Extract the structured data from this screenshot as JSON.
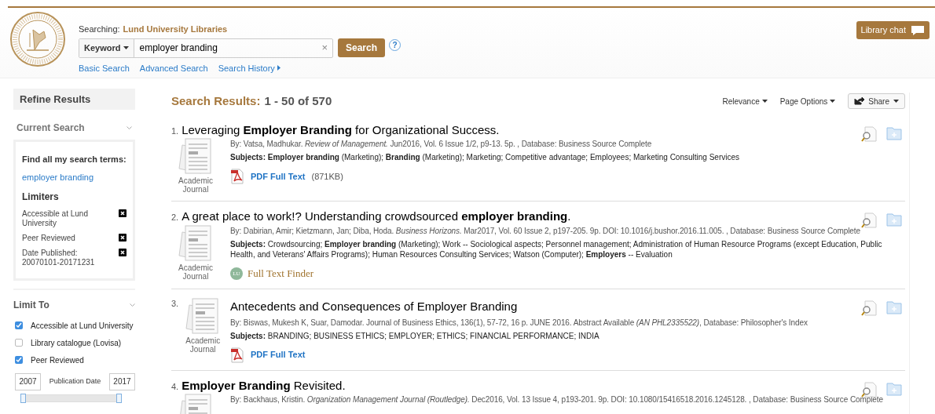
{
  "header": {
    "searching_label": "Searching:",
    "searching_target": "Lund University Libraries",
    "field_type": "Keyword",
    "query": "employer branding",
    "clear": "×",
    "search_button": "Search",
    "help": "?",
    "links": [
      {
        "label": "Basic Search",
        "arrow": false
      },
      {
        "label": "Advanced Search",
        "arrow": false
      },
      {
        "label": "Search History",
        "arrow": true
      }
    ],
    "chat_button": "Library chat"
  },
  "sidebar": {
    "title": "Refine Results",
    "current_search": {
      "heading": "Current Search",
      "find_label": "Find all my search terms:",
      "term": "employer branding",
      "limiters_heading": "Limiters",
      "limiters": [
        {
          "label": "Accessible at Lund University"
        },
        {
          "label": "Peer Reviewed"
        },
        {
          "label": "Date Published: 20070101-20171231"
        }
      ]
    },
    "limit_to": {
      "heading": "Limit To",
      "options": [
        {
          "label": "Accessible at Lund University",
          "checked": true
        },
        {
          "label": "Library catalogue (Lovisa)",
          "checked": false
        },
        {
          "label": "Peer Reviewed",
          "checked": true
        }
      ],
      "date_from": "2007",
      "date_label": "Publication Date",
      "date_to": "2017",
      "slider_thumbs": [
        {
          "level": 0
        },
        {
          "level": 1
        }
      ]
    }
  },
  "results": {
    "heading": "Search Results:",
    "range": "1 - 50 of 570",
    "sort": "Relevance",
    "page_options": "Page Options",
    "share": "Share",
    "items": [
      {
        "number": "1.",
        "title": "Leveraging **Employer Branding** for Organizational Success.",
        "kind": "stacked",
        "type": "Academic Journal",
        "byline": "By: Vatsa, Madhukar. *Review of Management.* Jun2016, Vol. 6 Issue 1/2, p9-13. 5p. , Database: Business Source Complete",
        "subjects": "**Subjects: Employer branding** (Marketing); **Branding** (Marketing); Marketing; Competitive advantage; Employees; Marketing Consulting Services",
        "link": {
          "kind": "pdf",
          "label": "PDF Full Text",
          "size": "(871KB)"
        }
      },
      {
        "number": "2.",
        "title": "A great place to work!? Understanding crowdsourced **employer branding**.",
        "kind": "stacked",
        "type": "Academic Journal",
        "byline": "By: Dabirian, Amir; Kietzmann, Jan; Diba, Hoda. *Business Horizons.* Mar2017, Vol. 60 Issue 2, p197-205. 9p. DOI: 10.1016/j.bushor.2016.11.005. , Database: Business Source Complete",
        "subjects": "**Subjects:** Crowdsourcing; **Employer branding** (Marketing); Work -- Sociological aspects; Personnel management; Administration of Human Resource Programs (except Education, Public Health, and Veterans' Affairs Programs); Human Resources Consulting Services; Watson (Computer); **Employers** -- Evaluation",
        "link": {
          "kind": "finder",
          "label": "Full Text Finder",
          "badge": "LU"
        }
      },
      {
        "number": "3.",
        "title": "Antecedents and Consequences of Employer Branding",
        "kind": "inline",
        "type": "Academic Journal",
        "byline": "By: Biswas, Mukesh K, Suar, Damodar. Journal of Business Ethics, 136(1), 57-72, 16 p. JUNE 2016. Abstract Available *(AN PHL2335522)*, Database: Philosopher's Index",
        "subjects": "**Subjects:** BRANDING; BUSINESS ETHICS; EMPLOYER; ETHICS; FINANCIAL PERFORMANCE; INDIA",
        "link": {
          "kind": "pdf",
          "label": "PDF Full Text"
        }
      },
      {
        "number": "4.",
        "title": "**Employer Branding** Revisited.",
        "kind": "stacked",
        "byline": "By: Backhaus, Kristin. *Organization Management Journal (Routledge).* Dec2016, Vol. 13 Issue 4, p193-201. 9p. DOI: 10.1080/15416518.2016.1245128. , Database: Business Source Complete"
      }
    ]
  }
}
